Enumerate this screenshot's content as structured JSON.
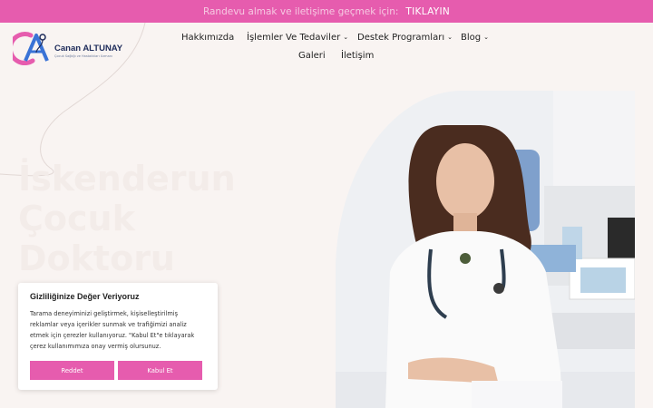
{
  "announcement": {
    "message": "Randevu almak ve iletişime geçmek için:",
    "cta": "TIKLAYIN"
  },
  "logo": {
    "name": "Canan ALTUNAY",
    "tagline": "Çocuk Sağlığı ve Hastalıkları Uzmanı"
  },
  "nav": {
    "about": "Hakkımızda",
    "treatments": "İşlemler Ve Tedaviler",
    "support": "Destek Programları",
    "blog": "Blog",
    "gallery": "Galeri",
    "contact": "İletişim"
  },
  "hero": {
    "title": "İskenderun Çocuk Doktoru"
  },
  "cookie": {
    "title": "Gizliliğinize Değer Veriyoruz",
    "text": "Tarama deneyiminizi geliştirmek, kişiselleştirilmiş reklamlar veya içerikler sunmak ve trafiğimizi analiz etmek için çerezler kullanıyoruz. \"Kabul Et\"e tıklayarak çerez kullanımımıza onay vermiş olursunuz.",
    "reject": "Reddet",
    "accept": "Kabul Et"
  },
  "colors": {
    "accent": "#e65cae",
    "background": "#f9f4f2"
  }
}
